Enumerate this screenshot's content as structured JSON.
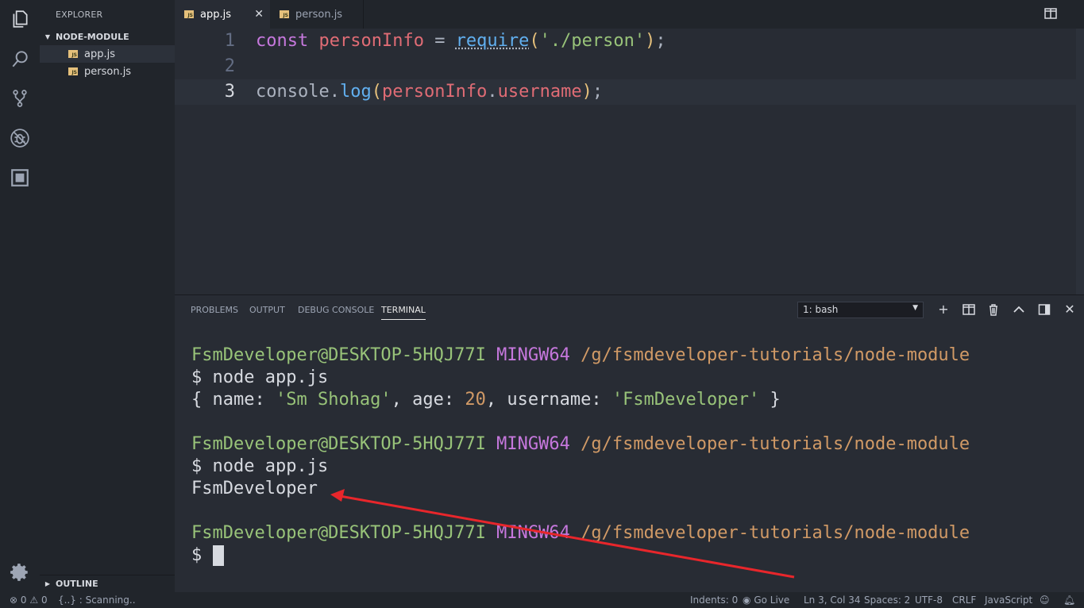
{
  "sidebar": {
    "title": "EXPLORER",
    "section": "NODE-MODULE",
    "files": [
      {
        "name": "app.js",
        "icon_text": "JS"
      },
      {
        "name": "person.js",
        "icon_text": "JS"
      }
    ],
    "outline": "OUTLINE"
  },
  "tabs": [
    {
      "label": "app.js",
      "icon_text": "JS"
    },
    {
      "label": "person.js",
      "icon_text": "JS"
    }
  ],
  "editor": {
    "lines": [
      {
        "number": "1",
        "tokens": [
          "const",
          "personInfo",
          "=",
          "require",
          "(",
          "'./person'",
          ")",
          ";"
        ]
      },
      {
        "number": "2",
        "tokens": []
      },
      {
        "number": "3",
        "tokens": [
          "console",
          ".",
          "log",
          "(",
          "personInfo",
          ".",
          "username",
          ")",
          ";"
        ]
      }
    ]
  },
  "panel": {
    "tabs": [
      "PROBLEMS",
      "OUTPUT",
      "DEBUG CONSOLE",
      "TERMINAL"
    ],
    "terminal_select": "1: bash",
    "icons": [
      "plus-icon",
      "split-icon",
      "trash-icon",
      "chevron-up-icon",
      "maximize-icon",
      "close-icon"
    ]
  },
  "terminal": {
    "prompt_user": "FsmDeveloper@DESKTOP-5HQJ77I",
    "prompt_env": "MINGW64",
    "prompt_path": "/g/fsmdeveloper-tutorials/node-module",
    "dollar": "$",
    "cmd1": "node app.js",
    "obj_open": "{ name: ",
    "obj_name": "'Sm Shohag'",
    "obj_mid1": ", age: ",
    "obj_age": "20",
    "obj_mid2": ", username: ",
    "obj_user": "'FsmDeveloper'",
    "obj_close": " }",
    "cmd2": "node app.js",
    "output2": "FsmDeveloper"
  },
  "status": {
    "errors": "0",
    "warnings": "0",
    "scanning": "{..} : Scanning..",
    "indents": "Indents: 0",
    "golive": "Go Live",
    "position": "Ln 3, Col 34",
    "spaces": "Spaces: 2",
    "encoding": "UTF-8",
    "eol": "CRLF",
    "language": "JavaScript"
  },
  "colors": {
    "background": "#282c34",
    "sidebar": "#21252b",
    "annotation_arrow": "#e8262b"
  }
}
